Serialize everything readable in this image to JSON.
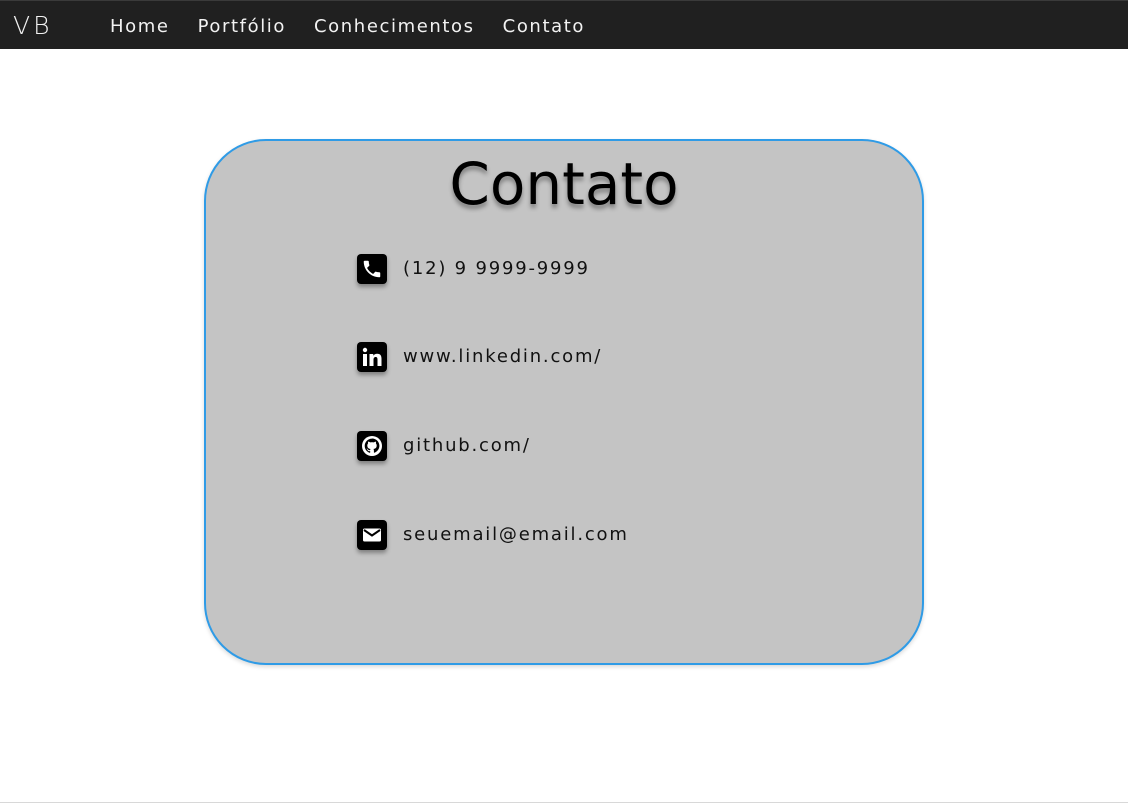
{
  "nav": {
    "brand": "VB",
    "links": [
      {
        "label": "Home"
      },
      {
        "label": "Portfólio"
      },
      {
        "label": "Conhecimentos"
      },
      {
        "label": "Contato"
      }
    ]
  },
  "contact": {
    "title": "Contato",
    "items": [
      {
        "icon": "phone-icon",
        "text": "(12) 9 9999-9999"
      },
      {
        "icon": "linkedin-icon",
        "text": "www.linkedin.com/"
      },
      {
        "icon": "github-icon",
        "text": "github.com/"
      },
      {
        "icon": "email-icon",
        "text": "seuemail@email.com"
      }
    ]
  },
  "colors": {
    "navbar_bg": "#202020",
    "card_bg": "#c4c4c4",
    "card_border": "#2f9be6"
  }
}
